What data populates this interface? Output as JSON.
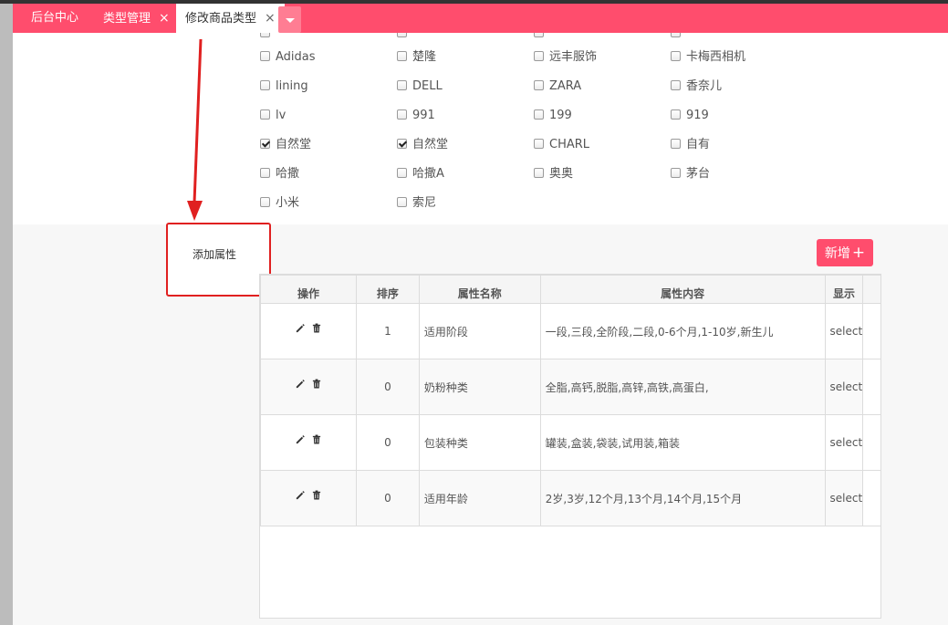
{
  "tabs": [
    {
      "label": "后台中心",
      "closable": false,
      "active": false
    },
    {
      "label": "类型管理",
      "closable": true,
      "active": false
    },
    {
      "label": "修改商品类型",
      "closable": true,
      "active": true
    }
  ],
  "tab_close_glyph": "×",
  "brands": [
    [
      {
        "label": "Adidas",
        "checked": false
      },
      {
        "label": "楚隆",
        "checked": false
      },
      {
        "label": "远丰服饰",
        "checked": false
      },
      {
        "label": "卡梅西相机",
        "checked": false
      }
    ],
    [
      {
        "label": "lining",
        "checked": false
      },
      {
        "label": "DELL",
        "checked": false
      },
      {
        "label": "ZARA",
        "checked": false
      },
      {
        "label": "香奈儿",
        "checked": false
      }
    ],
    [
      {
        "label": "lv",
        "checked": false
      },
      {
        "label": "991",
        "checked": false
      },
      {
        "label": "199",
        "checked": false
      },
      {
        "label": "919",
        "checked": false
      }
    ],
    [
      {
        "label": "自然堂",
        "checked": true
      },
      {
        "label": "自然堂",
        "checked": true
      },
      {
        "label": "CHARL",
        "checked": false
      },
      {
        "label": "自有",
        "checked": false
      }
    ],
    [
      {
        "label": "哈撒",
        "checked": false
      },
      {
        "label": "哈撒A",
        "checked": false
      },
      {
        "label": "奥奥",
        "checked": false
      },
      {
        "label": "茅台",
        "checked": false
      }
    ],
    [
      {
        "label": "小米",
        "checked": false
      },
      {
        "label": "索尼",
        "checked": false
      }
    ]
  ],
  "add_attribute_label": "添加属性",
  "add_button": {
    "label": "新增",
    "plus": "+"
  },
  "table": {
    "headers": [
      "操作",
      "排序",
      "属性名称",
      "属性内容",
      "显示"
    ],
    "rows": [
      {
        "sort": "1",
        "name": "适用阶段",
        "content": "一段,三段,全阶段,二段,0-6个月,1-10岁,新生儿",
        "show": "select"
      },
      {
        "sort": "0",
        "name": "奶粉种类",
        "content": "全脂,高钙,脱脂,高锌,高铁,高蛋白,",
        "show": "select"
      },
      {
        "sort": "0",
        "name": "包装种类",
        "content": "罐装,盒装,袋装,试用装,箱装",
        "show": "select"
      },
      {
        "sort": "0",
        "name": "适用年龄",
        "content": "2岁,3岁,12个月,13个月,14个月,15个月",
        "show": "select"
      }
    ]
  },
  "colors": {
    "accent": "#ff4d6d",
    "annotation": "#e02020"
  },
  "icons": {
    "edit": "pencil-icon",
    "delete": "trash-icon",
    "dropdown": "caret-down-icon"
  }
}
